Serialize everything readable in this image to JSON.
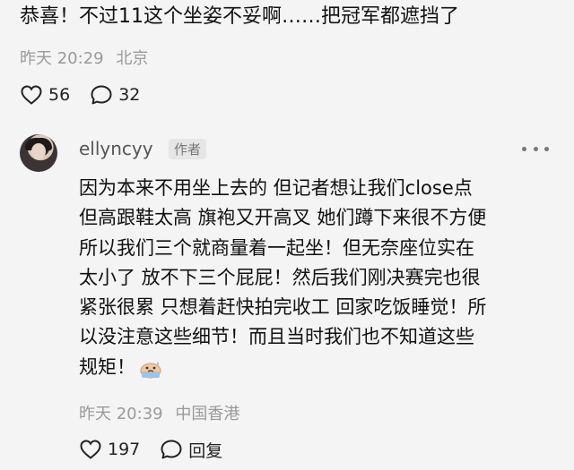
{
  "top_comment": {
    "text": "恭喜！不过11这个坐姿不妥啊……把冠军都遮挡了",
    "time": "昨天 20:29",
    "location": "北京",
    "likes": "56",
    "comments": "32"
  },
  "reply": {
    "username": "ellyncyy",
    "badge": "作者",
    "lines": [
      "因为本来不用坐上去的 但记者想让我们close点",
      "但高跟鞋太高 旗袍又开高叉 她们蹲下来很不方便",
      "所以我们三个就商量着一起坐！但无奈座位实在",
      "太小了 放不下三个屁屁！然后我们刚决赛完也很",
      "紧张很累 只想着赶快拍完收工 回家吃饭睡觉！所",
      "以没注意这些细节！而且当时我们也不知道这些",
      "规矩！"
    ],
    "emoji_icon": "sweating-emoji-icon",
    "time": "昨天 20:39",
    "location": "中国香港",
    "likes": "197",
    "reply_label": "回复"
  },
  "icons": {
    "like": "heart-icon",
    "comment": "comment-bubble-icon",
    "more": "more-dots-icon"
  },
  "colors": {
    "background": "#f4f4f4",
    "meta": "#9a9a9a",
    "text": "#111111"
  }
}
